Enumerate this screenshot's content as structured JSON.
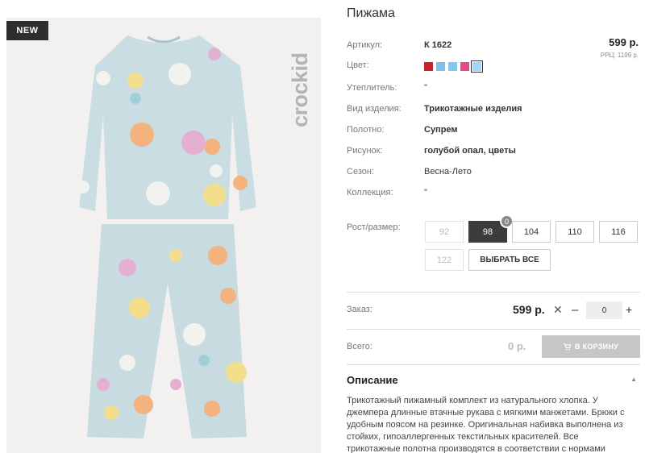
{
  "badge": "NEW",
  "brand": "crockid",
  "product": {
    "title": "Пижама",
    "price": "599 р.",
    "rrp": "РРЦ: 1199 р."
  },
  "specs": [
    {
      "label": "Артикул:",
      "value": "К 1622",
      "bold": true
    },
    {
      "label": "Цвет:",
      "value": "",
      "bold": false
    },
    {
      "label": "Утеплитель:",
      "value": "\"",
      "bold": false
    },
    {
      "label": "Вид изделия:",
      "value": "Трикотажные изделия",
      "bold": true
    },
    {
      "label": "Полотно:",
      "value": "Супрем",
      "bold": true
    },
    {
      "label": "Рисунок:",
      "value": "голубой опал, цветы",
      "bold": true
    },
    {
      "label": "Сезон:",
      "value": "Весна-Лето",
      "bold": false
    },
    {
      "label": "Коллекция:",
      "value": "\"",
      "bold": false
    }
  ],
  "colors": [
    "#c8232c",
    "#7fbfee",
    "#86c7f0",
    "#e64b86",
    "#a6d5f5"
  ],
  "sizes": {
    "label": "Рост/размер:",
    "options": [
      {
        "label": "92",
        "state": "disabled"
      },
      {
        "label": "98",
        "state": "active"
      },
      {
        "label": "104",
        "state": "normal"
      },
      {
        "label": "110",
        "state": "normal"
      },
      {
        "label": "116",
        "state": "normal"
      },
      {
        "label": "122",
        "state": "disabled"
      }
    ],
    "selected_count": "0",
    "select_all": "ВЫБРАТЬ ВСЕ"
  },
  "order": {
    "label": "Заказ:",
    "price": "599 р.",
    "remove": "✕",
    "minus": "–",
    "quantity": "0",
    "plus": "+"
  },
  "total": {
    "label": "Всего:",
    "value": "0 р.",
    "cart_button": "В КОРЗИНУ"
  },
  "description": {
    "heading": "Описание",
    "text": "Трикотажный пижамный комплект из натурального хлопка. У джемпера длинные втачные рукава с мягкими манжетами. Брюки с удобным поясом на резинке. Оригинальная набивка выполнена из стойких, гипоаллергенных текстильных красителей. Все трикотажные полотна производятся в соответствии с нормами"
  }
}
